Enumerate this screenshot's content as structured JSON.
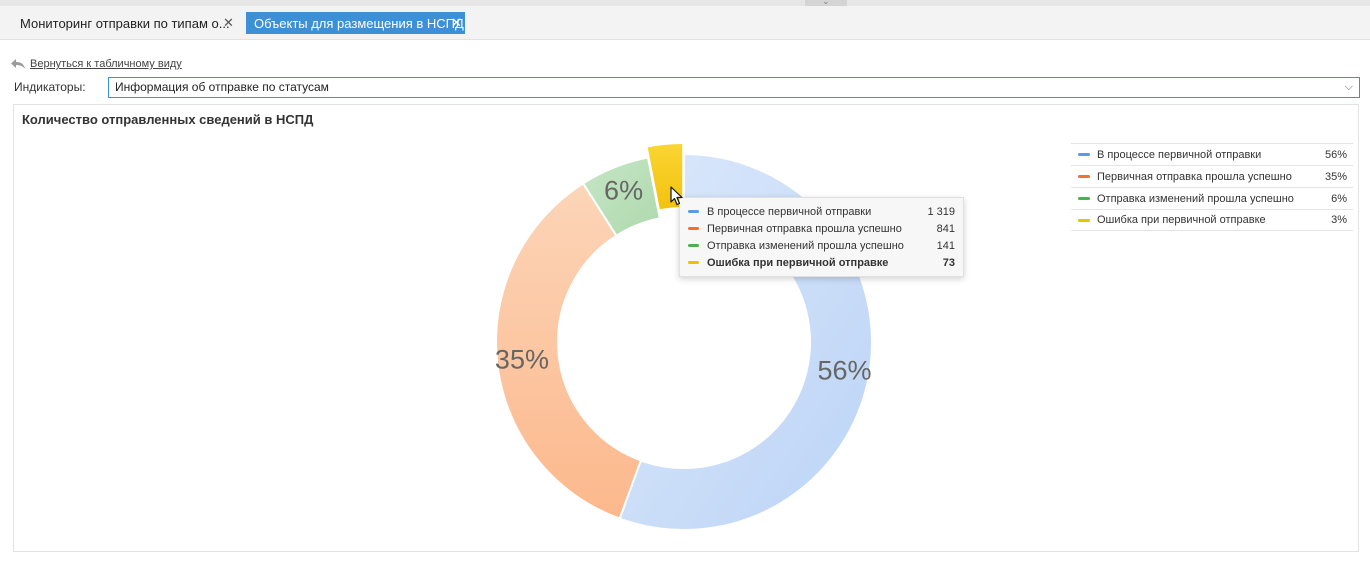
{
  "tabs": [
    {
      "label": "Мониторинг отправки по типам о...",
      "active": false
    },
    {
      "label": "Объекты для размещения в НСПД",
      "active": true
    }
  ],
  "back_link": "Вернуться к табличному виду",
  "indicators": {
    "label": "Индикаторы:",
    "value": "Информация об отправке по статусам"
  },
  "panel_title": "Количество отправленных сведений в НСПД",
  "colors": {
    "accent": "#3d8fd6",
    "series_blue": "#5b9be6",
    "series_orange": "#f2722c",
    "series_green": "#4caf50",
    "series_yellow": "#e8c300"
  },
  "chart_data": {
    "type": "pie",
    "donut": true,
    "series": [
      {
        "name": "В процессе первичной отправки",
        "value": 1319,
        "percent_label": "56%",
        "color": "#c9dcf8",
        "legend_color": "#5b9be6"
      },
      {
        "name": "Первичная отправка прошла успешно",
        "value": 841,
        "percent_label": "35%",
        "color": "#fdc29c",
        "legend_color": "#f2722c"
      },
      {
        "name": "Отправка изменений прошла успешно",
        "value": 141,
        "percent_label": "6%",
        "color": "#b9e0b8",
        "legend_color": "#4caf50"
      },
      {
        "name": "Ошибка при первичной отправке",
        "value": 73,
        "percent_label": "",
        "color": "#f7cd1a",
        "legend_color": "#e8c300",
        "highlighted": true
      }
    ],
    "legend_placement": "top-right",
    "legend_values": [
      "56%",
      "35%",
      "6%",
      "3%"
    ]
  },
  "tooltip": {
    "rows": [
      {
        "label": "В процессе первичной отправки",
        "value": "1 319",
        "color": "#5b9be6"
      },
      {
        "label": "Первичная отправка прошла успешно",
        "value": "841",
        "color": "#f2722c"
      },
      {
        "label": "Отправка изменений прошла успешно",
        "value": "141",
        "color": "#4caf50"
      },
      {
        "label": "Ошибка при первичной отправке",
        "value": "73",
        "color": "#e8c300",
        "bold": true
      }
    ]
  },
  "icons": {
    "back": "back-arrow-icon",
    "close": "close-icon",
    "chevron": "chevron-down-icon",
    "cursor": "mouse-cursor-icon"
  }
}
